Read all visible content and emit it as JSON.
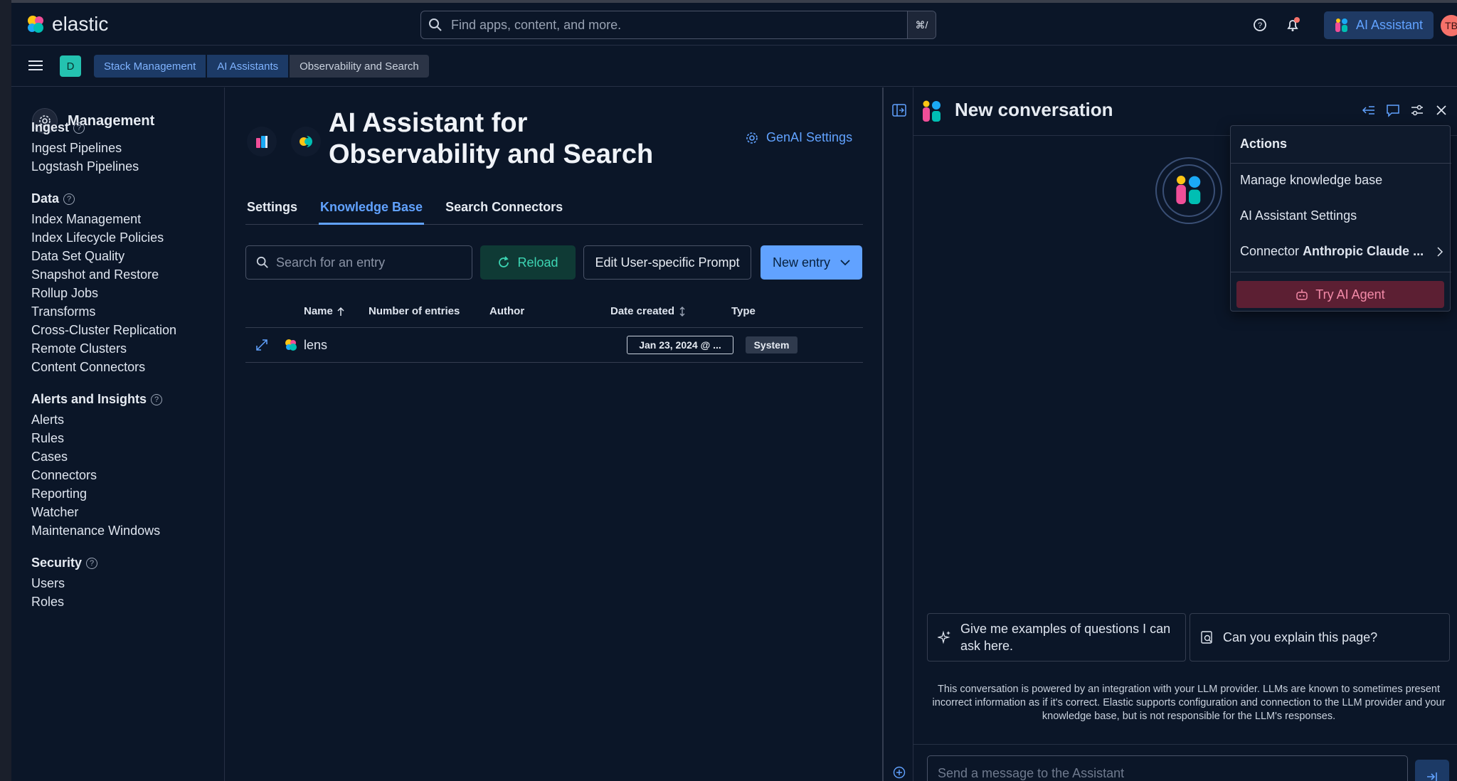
{
  "header": {
    "brand": "elastic",
    "search_placeholder": "Find apps, content, and more.",
    "search_shortcut": "⌘/",
    "ai_assistant_label": "AI Assistant",
    "avatar_initials": "TB"
  },
  "breadcrumbs": {
    "space": "D",
    "items": [
      "Stack Management",
      "AI Assistants",
      "Observability and Search"
    ]
  },
  "sidebar": {
    "title": "Management",
    "sections": [
      {
        "heading": "Ingest",
        "items": [
          "Ingest Pipelines",
          "Logstash Pipelines"
        ]
      },
      {
        "heading": "Data",
        "items": [
          "Index Management",
          "Index Lifecycle Policies",
          "Data Set Quality",
          "Snapshot and Restore",
          "Rollup Jobs",
          "Transforms",
          "Cross-Cluster Replication",
          "Remote Clusters",
          "Content Connectors"
        ]
      },
      {
        "heading": "Alerts and Insights",
        "items": [
          "Alerts",
          "Rules",
          "Cases",
          "Connectors",
          "Reporting",
          "Watcher",
          "Maintenance Windows"
        ]
      },
      {
        "heading": "Security",
        "items": [
          "Users",
          "Roles"
        ]
      }
    ]
  },
  "main": {
    "title": "AI Assistant for Observability and Search",
    "genai_settings": "GenAI Settings",
    "tabs": [
      "Settings",
      "Knowledge Base",
      "Search Connectors"
    ],
    "active_tab": "Knowledge Base",
    "search_placeholder": "Search for an entry",
    "reload_label": "Reload",
    "edit_prompt_label": "Edit User-specific Prompt",
    "new_entry_label": "New entry",
    "columns": [
      "Name",
      "Number of entries",
      "Author",
      "Date created",
      "Type"
    ],
    "rows": [
      {
        "name": "lens",
        "entries": "",
        "author": "",
        "date": "Jan 23, 2024 @ ...",
        "type": "System"
      }
    ]
  },
  "assistant": {
    "title": "New conversation",
    "actions_menu": {
      "title": "Actions",
      "items": [
        "Manage knowledge base",
        "AI Assistant Settings"
      ],
      "connector_label": "Connector",
      "connector_value": "Anthropic Claude ...",
      "try_agent": "Try AI Agent"
    },
    "suggestions": [
      "Give me examples of questions I can ask here.",
      "Can you explain this page?"
    ],
    "disclaimer": "This conversation is powered by an integration with your LLM provider. LLMs are known to sometimes present incorrect information as if it's correct. Elastic supports configuration and connection to the LLM provider and your knowledge base, but is not responsible for the LLM's responses.",
    "composer_placeholder": "Send a message to the Assistant"
  },
  "colors": {
    "background": "#0b1628",
    "accent": "#61a2ff",
    "reload_text": "#3dd6b4",
    "try_agent_bg": "#5c1f33",
    "avatar": "#f6726a"
  }
}
